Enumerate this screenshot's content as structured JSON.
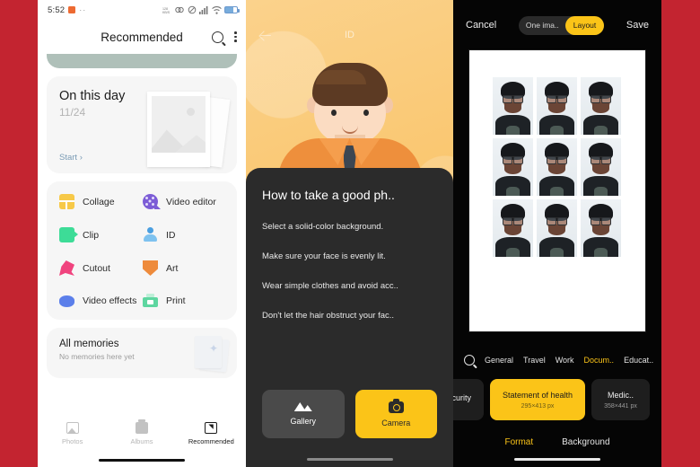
{
  "background_color": "#C32430",
  "panel1": {
    "status_bar": {
      "time": "5:52",
      "icons": [
        "alarm-square-icon",
        "more-dots-icon",
        "data-speed-icon",
        "link-icon",
        "mute-icon",
        "signal-icon",
        "wifi-icon",
        "battery-icon"
      ]
    },
    "app_bar": {
      "title": "Recommended",
      "search_icon": "search-icon",
      "menu_icon": "kebab-menu-icon"
    },
    "on_this_day": {
      "title": "On this day",
      "date": "11/24",
      "start_label": "Start ›"
    },
    "tools": [
      {
        "label": "Collage",
        "icon": "collage-icon",
        "color": "#F7C948"
      },
      {
        "label": "Video editor",
        "icon": "video-editor-icon",
        "color": "#7C5CD6"
      },
      {
        "label": "Clip",
        "icon": "clip-icon",
        "color": "#3DDC97"
      },
      {
        "label": "ID",
        "icon": "id-photo-icon",
        "color": "#4A9FE0"
      },
      {
        "label": "Cutout",
        "icon": "cutout-icon",
        "color": "#F0437E"
      },
      {
        "label": "Art",
        "icon": "art-icon",
        "color": "#EE8B3C"
      },
      {
        "label": "Video effects",
        "icon": "video-effects-icon",
        "color": "#5B7FEA"
      },
      {
        "label": "Print",
        "icon": "print-icon",
        "color": "#5ED6A0"
      }
    ],
    "memories": {
      "title": "All memories",
      "subtitle": "No memories here yet"
    },
    "nav": [
      {
        "label": "Photos",
        "icon": "photos-icon",
        "active": false
      },
      {
        "label": "Albums",
        "icon": "albums-icon",
        "active": false
      },
      {
        "label": "Recommended",
        "icon": "recommended-icon",
        "active": true
      }
    ]
  },
  "panel2": {
    "title": "ID",
    "back_icon": "back-arrow-icon",
    "sheet_title": "How to take a good ph..",
    "tips": [
      "Select a solid-color background.",
      "Make sure your face is evenly lit.",
      "Wear simple clothes and avoid acc..",
      "Don't let the hair obstruct your fac.."
    ],
    "buttons": [
      {
        "label": "Gallery",
        "icon": "gallery-icon",
        "color": "#4A4A4A"
      },
      {
        "label": "Camera",
        "icon": "camera-icon",
        "color": "#FBC418"
      }
    ]
  },
  "panel3": {
    "cancel_label": "Cancel",
    "save_label": "Save",
    "segment": {
      "option_off": "One ima..",
      "option_on": "Layout"
    },
    "photo_grid": {
      "rows": 3,
      "cols": 3,
      "count": 9
    },
    "categories": [
      {
        "label": "General",
        "active": false
      },
      {
        "label": "Travel",
        "active": false
      },
      {
        "label": "Work",
        "active": false
      },
      {
        "label": "Docum..",
        "active": true
      },
      {
        "label": "Educat..",
        "active": false
      }
    ],
    "search_icon": "search-icon",
    "documents": [
      {
        "name": "...ecurity",
        "size": "",
        "active": false
      },
      {
        "name": "Statement of health",
        "size": "295×413 px",
        "active": true
      },
      {
        "name": "Medic..",
        "size": "358×441 px",
        "active": false
      }
    ],
    "tabs": [
      {
        "label": "Format",
        "active": true
      },
      {
        "label": "Background",
        "active": false
      }
    ]
  }
}
